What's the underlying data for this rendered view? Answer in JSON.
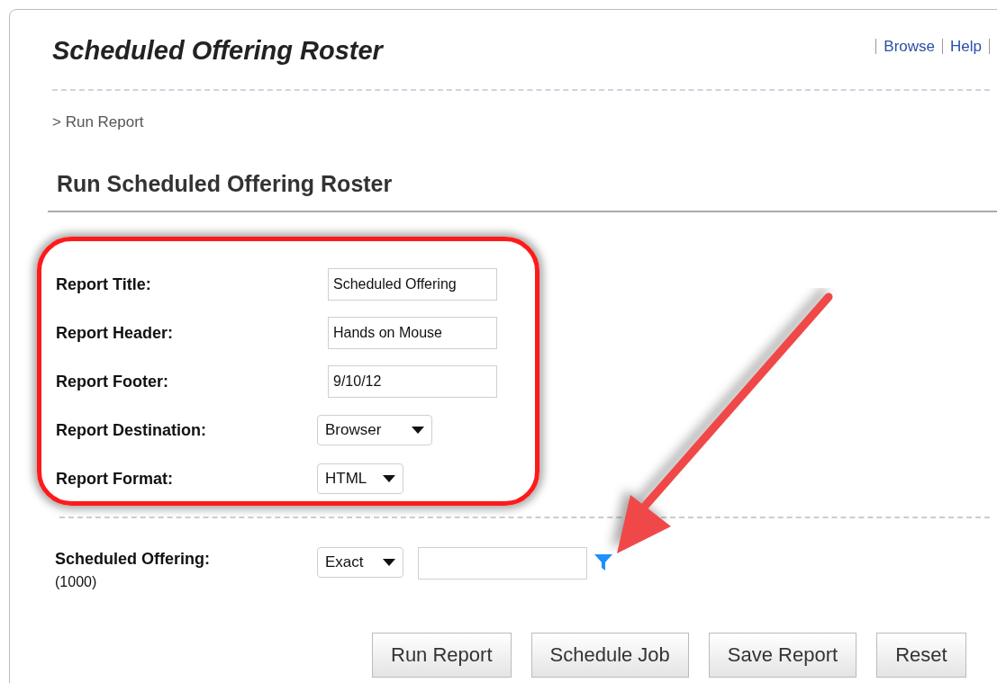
{
  "page_title": "Scheduled Offering Roster",
  "nav_links": [
    "Browse",
    "Help"
  ],
  "breadcrumb": "> Run Report",
  "heading": "Run Scheduled Offering Roster",
  "report_fields": [
    {
      "label": "Report Title:",
      "kind": "text",
      "value": "Scheduled Offering"
    },
    {
      "label": "Report Header:",
      "kind": "text",
      "value": "Hands on Mouse"
    },
    {
      "label": "Report Footer:",
      "kind": "text",
      "value": "9/10/12"
    },
    {
      "label": "Report Destination:",
      "kind": "select",
      "value": "Browser"
    },
    {
      "label": "Report Format:",
      "kind": "select",
      "value": "HTML"
    }
  ],
  "filter": {
    "label": "Scheduled Offering:",
    "note": "(1000)",
    "match": "Exact"
  },
  "buttons": [
    "Run Report",
    "Schedule Job",
    "Save Report",
    "Reset"
  ]
}
